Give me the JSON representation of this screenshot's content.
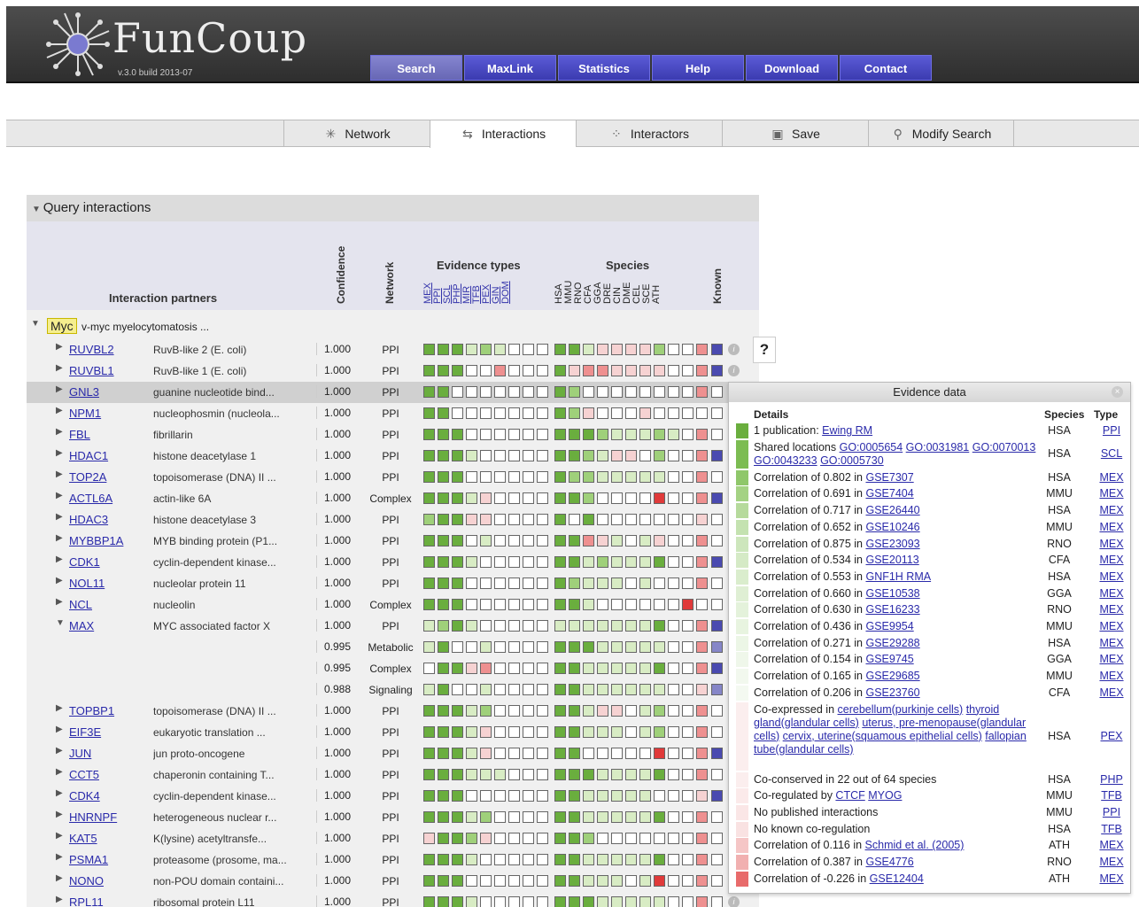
{
  "app": {
    "logo_text": "FunCoup",
    "version": "v.3.0 build 2013-07"
  },
  "nav": [
    {
      "label": "Search"
    },
    {
      "label": "MaxLink"
    },
    {
      "label": "Statistics"
    },
    {
      "label": "Help"
    },
    {
      "label": "Download"
    },
    {
      "label": "Contact"
    }
  ],
  "tabs": [
    {
      "label": "Network",
      "icon": "network-icon"
    },
    {
      "label": "Interactions",
      "icon": "interactions-icon"
    },
    {
      "label": "Interactors",
      "icon": "interactors-icon"
    },
    {
      "label": "Save",
      "icon": "save-icon"
    },
    {
      "label": "Modify Search",
      "icon": "search-icon"
    }
  ],
  "panel": {
    "title": "Query interactions"
  },
  "headers": {
    "partners": "Interaction partners",
    "confidence": "Confidence",
    "network": "Network",
    "evidence_types": "Evidence types",
    "species": "Species",
    "known": "Known"
  },
  "evidence_cols": [
    "MEX",
    "PPI",
    "SCL",
    "PHP",
    "MIR",
    "TFB",
    "PEX",
    "GIN",
    "DOM"
  ],
  "species_cols": [
    "HSA",
    "MMU",
    "RNO",
    "CFA",
    "GGA",
    "DRE",
    "CIN",
    "DME",
    "CEL",
    "SCE",
    "ATH"
  ],
  "query": {
    "symbol": "Myc",
    "description": "v-myc myelocytomatosis ..."
  },
  "colors": {
    "dg": "#6aae3e",
    "mg": "#9fd07a",
    "lg": "#d8ecc4",
    "p": "#f6d2d2",
    "r": "#ee9090",
    "dr": "#e03a3a",
    "w": "#ffffff",
    "kb": "#4a4ab0",
    "kl": "#8686c8"
  },
  "rows": [
    {
      "sym": "RUVBL2",
      "desc": "RuvB-like 2 (E. coli)",
      "conf": "1.000",
      "net": "PPI",
      "ev": "ggglmlwww",
      "sp": "gglppppmwwr",
      "kn": "kb"
    },
    {
      "sym": "RUVBL1",
      "desc": "RuvB-like 1 (E. coli)",
      "conf": "1.000",
      "net": "PPI",
      "ev": "gggwwrwww",
      "sp": "gprrppppwwr",
      "kn": "kb"
    },
    {
      "sym": "GNL3",
      "desc": "guanine nucleotide bind...",
      "conf": "1.000",
      "net": "PPI",
      "ev": "ggwwwwwww",
      "sp": "gmwwwwwwwwr",
      "kn": "w",
      "sel": true
    },
    {
      "sym": "NPM1",
      "desc": "nucleophosmin (nucleola...",
      "conf": "1.000",
      "net": "PPI",
      "ev": "ggwwwwwww",
      "sp": "gmpwwwpwwww",
      "kn": "w"
    },
    {
      "sym": "FBL",
      "desc": "fibrillarin",
      "conf": "1.000",
      "net": "PPI",
      "ev": "gggwwwwww",
      "sp": "gggmlllmlwr",
      "kn": "w"
    },
    {
      "sym": "HDAC1",
      "desc": "histone deacetylase 1",
      "conf": "1.000",
      "net": "PPI",
      "ev": "ggglwwwww",
      "sp": "ggmlppwmwwr",
      "kn": "kb"
    },
    {
      "sym": "TOP2A",
      "desc": "topoisomerase (DNA) II ...",
      "conf": "1.000",
      "net": "PPI",
      "ev": "gggwwwwww",
      "sp": "gmmlllllwwr",
      "kn": "w"
    },
    {
      "sym": "ACTL6A",
      "desc": "actin-like 6A",
      "conf": "1.000",
      "net": "Complex",
      "ev": "ggglpwwww",
      "sp": "ggmwwwwdwwr",
      "kn": "kb"
    },
    {
      "sym": "HDAC3",
      "desc": "histone deacetylase 3",
      "conf": "1.000",
      "net": "PPI",
      "ev": "mggppwwww",
      "sp": "gwgwwwwwwwp",
      "kn": "w"
    },
    {
      "sym": "MYBBP1A",
      "desc": "MYB binding protein (P1...",
      "conf": "1.000",
      "net": "PPI",
      "ev": "gggwlwwww",
      "sp": "ggrplwlpwwr",
      "kn": "w"
    },
    {
      "sym": "CDK1",
      "desc": "cyclin-dependent kinase...",
      "conf": "1.000",
      "net": "PPI",
      "ev": "ggglwwwww",
      "sp": "gglmlllgwwr",
      "kn": "kb"
    },
    {
      "sym": "NOL11",
      "desc": "nucleolar protein 11",
      "conf": "1.000",
      "net": "PPI",
      "ev": "gggwwwwww",
      "sp": "gmlllwlwwwr",
      "kn": "w"
    },
    {
      "sym": "NCL",
      "desc": "nucleolin",
      "conf": "1.000",
      "net": "Complex",
      "ev": "gggwwwwww",
      "sp": "gglwwwwwwdw",
      "kn": "w"
    },
    {
      "sym": "MAX",
      "desc": "MYC associated factor X",
      "conf": "1.000",
      "net": "PPI",
      "ev": "lmglwwwww",
      "sp": "lllllllgwwr",
      "kn": "kb",
      "exp": true
    },
    {
      "sym": "",
      "desc": "",
      "conf": "0.995",
      "net": "Metabolic",
      "ev": "lgwwlwwww",
      "sp": "ggglllllwwr",
      "kn": "kl",
      "sub": true
    },
    {
      "sym": "",
      "desc": "",
      "conf": "0.995",
      "net": "Complex",
      "ev": "wggprwwww",
      "sp": "gglllllgwwr",
      "kn": "kb",
      "sub": true
    },
    {
      "sym": "",
      "desc": "",
      "conf": "0.988",
      "net": "Signaling",
      "ev": "lgwwlwwww",
      "sp": "ggllllllwwp",
      "kn": "kl",
      "sub": true
    },
    {
      "sym": "TOPBP1",
      "desc": "topoisomerase (DNA) II ...",
      "conf": "1.000",
      "net": "PPI",
      "ev": "ggglmwwww",
      "sp": "gglppwlmwwr",
      "kn": "w"
    },
    {
      "sym": "EIF3E",
      "desc": "eukaryotic translation ...",
      "conf": "1.000",
      "net": "PPI",
      "ev": "ggglpwwww",
      "sp": "gglllwlmwwr",
      "kn": "w"
    },
    {
      "sym": "JUN",
      "desc": "jun proto-oncogene",
      "conf": "1.000",
      "net": "PPI",
      "ev": "ggglpwwww",
      "sp": "ggwwwwwdwwr",
      "kn": "kb"
    },
    {
      "sym": "CCT5",
      "desc": "chaperonin containing T...",
      "conf": "1.000",
      "net": "PPI",
      "ev": "ggglllwww",
      "sp": "gggllllgwwr",
      "kn": "w"
    },
    {
      "sym": "CDK4",
      "desc": "cyclin-dependent kinase...",
      "conf": "1.000",
      "net": "PPI",
      "ev": "gggwwwwww",
      "sp": "gglllllwwwp",
      "kn": "kb"
    },
    {
      "sym": "HNRNPF",
      "desc": "heterogeneous nuclear r...",
      "conf": "1.000",
      "net": "PPI",
      "ev": "ggglmwwww",
      "sp": "gglllllgwwr",
      "kn": "w"
    },
    {
      "sym": "KAT5",
      "desc": "K(lysine) acetyltransfe...",
      "conf": "1.000",
      "net": "PPI",
      "ev": "pggmpwwww",
      "sp": "ggmwwwwwwwr",
      "kn": "w"
    },
    {
      "sym": "PSMA1",
      "desc": "proteasome (prosome, ma...",
      "conf": "1.000",
      "net": "PPI",
      "ev": "ggglwwwww",
      "sp": "gglllllgwwr",
      "kn": "w"
    },
    {
      "sym": "NONO",
      "desc": "non-POU domain containi...",
      "conf": "1.000",
      "net": "PPI",
      "ev": "gggwwwwww",
      "sp": "gglllwldwwr",
      "kn": "w"
    },
    {
      "sym": "RPL11",
      "desc": "ribosomal protein L11",
      "conf": "1.000",
      "net": "PPI",
      "ev": "ggglwwwww",
      "sp": "ggglllllwwr",
      "kn": "w"
    }
  ],
  "help_label": "?",
  "evidence_panel": {
    "title": "Evidence data",
    "h_details": "Details",
    "h_species": "Species",
    "h_type": "Type",
    "rows": [
      {
        "sw": "#6aae3e",
        "parts": [
          "1 publication: ",
          "@Ewing RM"
        ],
        "sp": "HSA",
        "ty": "PPI"
      },
      {
        "sw": "#7cbc52",
        "parts": [
          "Shared locations ",
          "@GO:0005654",
          " ",
          "@GO:0031981",
          " ",
          "@GO:0070013",
          " ",
          "@GO:0043233",
          " ",
          "@GO:0005730"
        ],
        "sp": "HSA",
        "ty": "SCL",
        "lines": 2
      },
      {
        "sw": "#8fc76a",
        "parts": [
          "Correlation of 0.802 in ",
          "@GSE7307"
        ],
        "sp": "HSA",
        "ty": "MEX"
      },
      {
        "sw": "#a4d283",
        "parts": [
          "Correlation of 0.691 in ",
          "@GSE7404"
        ],
        "sp": "MMU",
        "ty": "MEX"
      },
      {
        "sw": "#b6da9c",
        "parts": [
          "Correlation of 0.717 in ",
          "@GSE26440"
        ],
        "sp": "HSA",
        "ty": "MEX"
      },
      {
        "sw": "#c4e2b0",
        "parts": [
          "Correlation of 0.652 in ",
          "@GSE10246"
        ],
        "sp": "MMU",
        "ty": "MEX"
      },
      {
        "sw": "#cde6bc",
        "parts": [
          "Correlation of 0.875 in ",
          "@GSE23093"
        ],
        "sp": "RNO",
        "ty": "MEX"
      },
      {
        "sw": "#d5eac6",
        "parts": [
          "Correlation of 0.534 in ",
          "@GSE20113"
        ],
        "sp": "CFA",
        "ty": "MEX"
      },
      {
        "sw": "#daedcd",
        "parts": [
          "Correlation of 0.553 in ",
          "@GNF1H RMA"
        ],
        "sp": "HSA",
        "ty": "MEX"
      },
      {
        "sw": "#dfefd4",
        "parts": [
          "Correlation of 0.660 in ",
          "@GSE10538"
        ],
        "sp": "GGA",
        "ty": "MEX"
      },
      {
        "sw": "#e4f2db",
        "parts": [
          "Correlation of 0.630 in ",
          "@GSE16233"
        ],
        "sp": "RNO",
        "ty": "MEX"
      },
      {
        "sw": "#e8f4e0",
        "parts": [
          "Correlation of 0.436 in ",
          "@GSE9954"
        ],
        "sp": "MMU",
        "ty": "MEX"
      },
      {
        "sw": "#ecf6e6",
        "parts": [
          "Correlation of 0.271 in ",
          "@GSE29288"
        ],
        "sp": "HSA",
        "ty": "MEX"
      },
      {
        "sw": "#eff7ea",
        "parts": [
          "Correlation of 0.154 in ",
          "@GSE9745"
        ],
        "sp": "GGA",
        "ty": "MEX"
      },
      {
        "sw": "#f2f8ee",
        "parts": [
          "Correlation of 0.165 in ",
          "@GSE29685"
        ],
        "sp": "MMU",
        "ty": "MEX"
      },
      {
        "sw": "#f4f9f1",
        "parts": [
          "Correlation of 0.206 in ",
          "@GSE23760"
        ],
        "sp": "CFA",
        "ty": "MEX"
      },
      {
        "sw": "#fbeeee",
        "parts": [
          "Co-expressed in ",
          "@cerebellum(purkinje cells)",
          " ",
          "@thyroid gland(glandular cells)",
          " ",
          "@uterus, pre-menopause(glandular cells)",
          " ",
          "@cervix, uterine(squamous epithelial cells)",
          " ",
          "@fallopian tube(glandular cells)"
        ],
        "sp": "HSA",
        "ty": "PEX",
        "lines": 5
      },
      {
        "sw": "#fbeeee",
        "parts": [
          "Co-conserved in 22 out of 64 species"
        ],
        "sp": "HSA",
        "ty": "PHP"
      },
      {
        "sw": "#fbeaea",
        "parts": [
          "Co-regulated by ",
          "@CTCF",
          " ",
          "@MYOG"
        ],
        "sp": "MMU",
        "ty": "TFB"
      },
      {
        "sw": "#fae6e6",
        "parts": [
          "No published interactions"
        ],
        "sp": "MMU",
        "ty": "PPI"
      },
      {
        "sw": "#f9e2e2",
        "parts": [
          "No known co-regulation"
        ],
        "sp": "HSA",
        "ty": "TFB"
      },
      {
        "sw": "#f5c6c6",
        "parts": [
          "Correlation of 0.116 in ",
          "@Schmid et al. (2005)"
        ],
        "sp": "ATH",
        "ty": "MEX"
      },
      {
        "sw": "#f1b0b0",
        "parts": [
          "Correlation of 0.387 in ",
          "@GSE4776"
        ],
        "sp": "RNO",
        "ty": "MEX"
      },
      {
        "sw": "#e86b6b",
        "parts": [
          "Correlation of -0.226 in ",
          "@GSE12404"
        ],
        "sp": "ATH",
        "ty": "MEX"
      }
    ]
  }
}
